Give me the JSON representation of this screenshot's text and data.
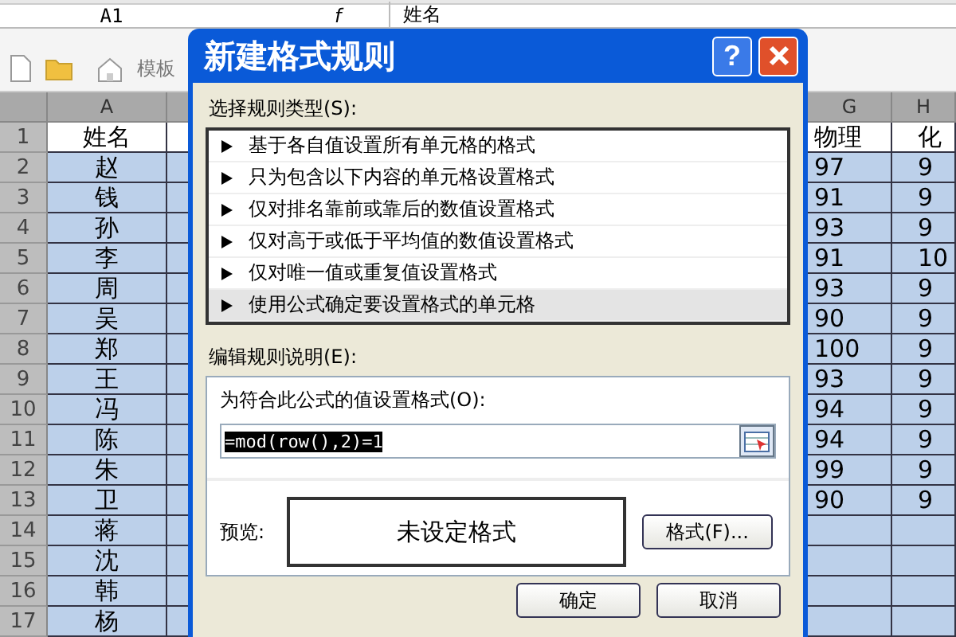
{
  "formula_bar": {
    "name_box": "A1",
    "fx": "f",
    "value": "姓名"
  },
  "toolbar": {
    "template_label": "模板"
  },
  "sheet": {
    "columns": [
      "A",
      "G",
      "H"
    ],
    "rows": [
      {
        "number": "1",
        "a": "姓名",
        "g": "物理",
        "h": "化",
        "selected": false
      },
      {
        "number": "2",
        "a": "赵",
        "g": "97",
        "h": "9",
        "selected": true
      },
      {
        "number": "3",
        "a": "钱",
        "g": "91",
        "h": "9",
        "selected": true
      },
      {
        "number": "4",
        "a": "孙",
        "g": "93",
        "h": "9",
        "selected": true
      },
      {
        "number": "5",
        "a": "李",
        "g": "91",
        "h": "10",
        "selected": true
      },
      {
        "number": "6",
        "a": "周",
        "g": "93",
        "h": "9",
        "selected": true
      },
      {
        "number": "7",
        "a": "吴",
        "g": "90",
        "h": "9",
        "selected": true
      },
      {
        "number": "8",
        "a": "郑",
        "g": "100",
        "h": "9",
        "selected": true
      },
      {
        "number": "9",
        "a": "王",
        "g": "93",
        "h": "9",
        "selected": true
      },
      {
        "number": "10",
        "a": "冯",
        "g": "94",
        "h": "9",
        "selected": true
      },
      {
        "number": "11",
        "a": "陈",
        "g": "94",
        "h": "9",
        "selected": true
      },
      {
        "number": "12",
        "a": "朱",
        "g": "99",
        "h": "9",
        "selected": true
      },
      {
        "number": "13",
        "a": "卫",
        "g": "90",
        "h": "9",
        "selected": true
      },
      {
        "number": "14",
        "a": "蒋",
        "g": "",
        "h": "",
        "selected": true
      },
      {
        "number": "15",
        "a": "沈",
        "g": "",
        "h": "",
        "selected": true
      },
      {
        "number": "16",
        "a": "韩",
        "g": "",
        "h": "",
        "selected": true
      },
      {
        "number": "17",
        "a": "杨",
        "g": "",
        "h": "",
        "selected": true
      }
    ]
  },
  "dialog": {
    "title": "新建格式规则",
    "help": "?",
    "rule_type_label": "选择规则类型(S):",
    "rule_types": [
      {
        "label": "基于各自值设置所有单元格的格式",
        "selected": false
      },
      {
        "label": "只为包含以下内容的单元格设置格式",
        "selected": false
      },
      {
        "label": "仅对排名靠前或靠后的数值设置格式",
        "selected": false
      },
      {
        "label": "仅对高于或低于平均值的数值设置格式",
        "selected": false
      },
      {
        "label": "仅对唯一值或重复值设置格式",
        "selected": false
      },
      {
        "label": "使用公式确定要设置格式的单元格",
        "selected": true
      }
    ],
    "edit_label": "编辑规则说明(E):",
    "formula_label": "为符合此公式的值设置格式(O):",
    "formula": "=mod(row(),2)=1",
    "preview_label": "预览:",
    "preview_text": "未设定格式",
    "format_button": "格式(F)...",
    "ok": "确定",
    "cancel": "取消"
  }
}
